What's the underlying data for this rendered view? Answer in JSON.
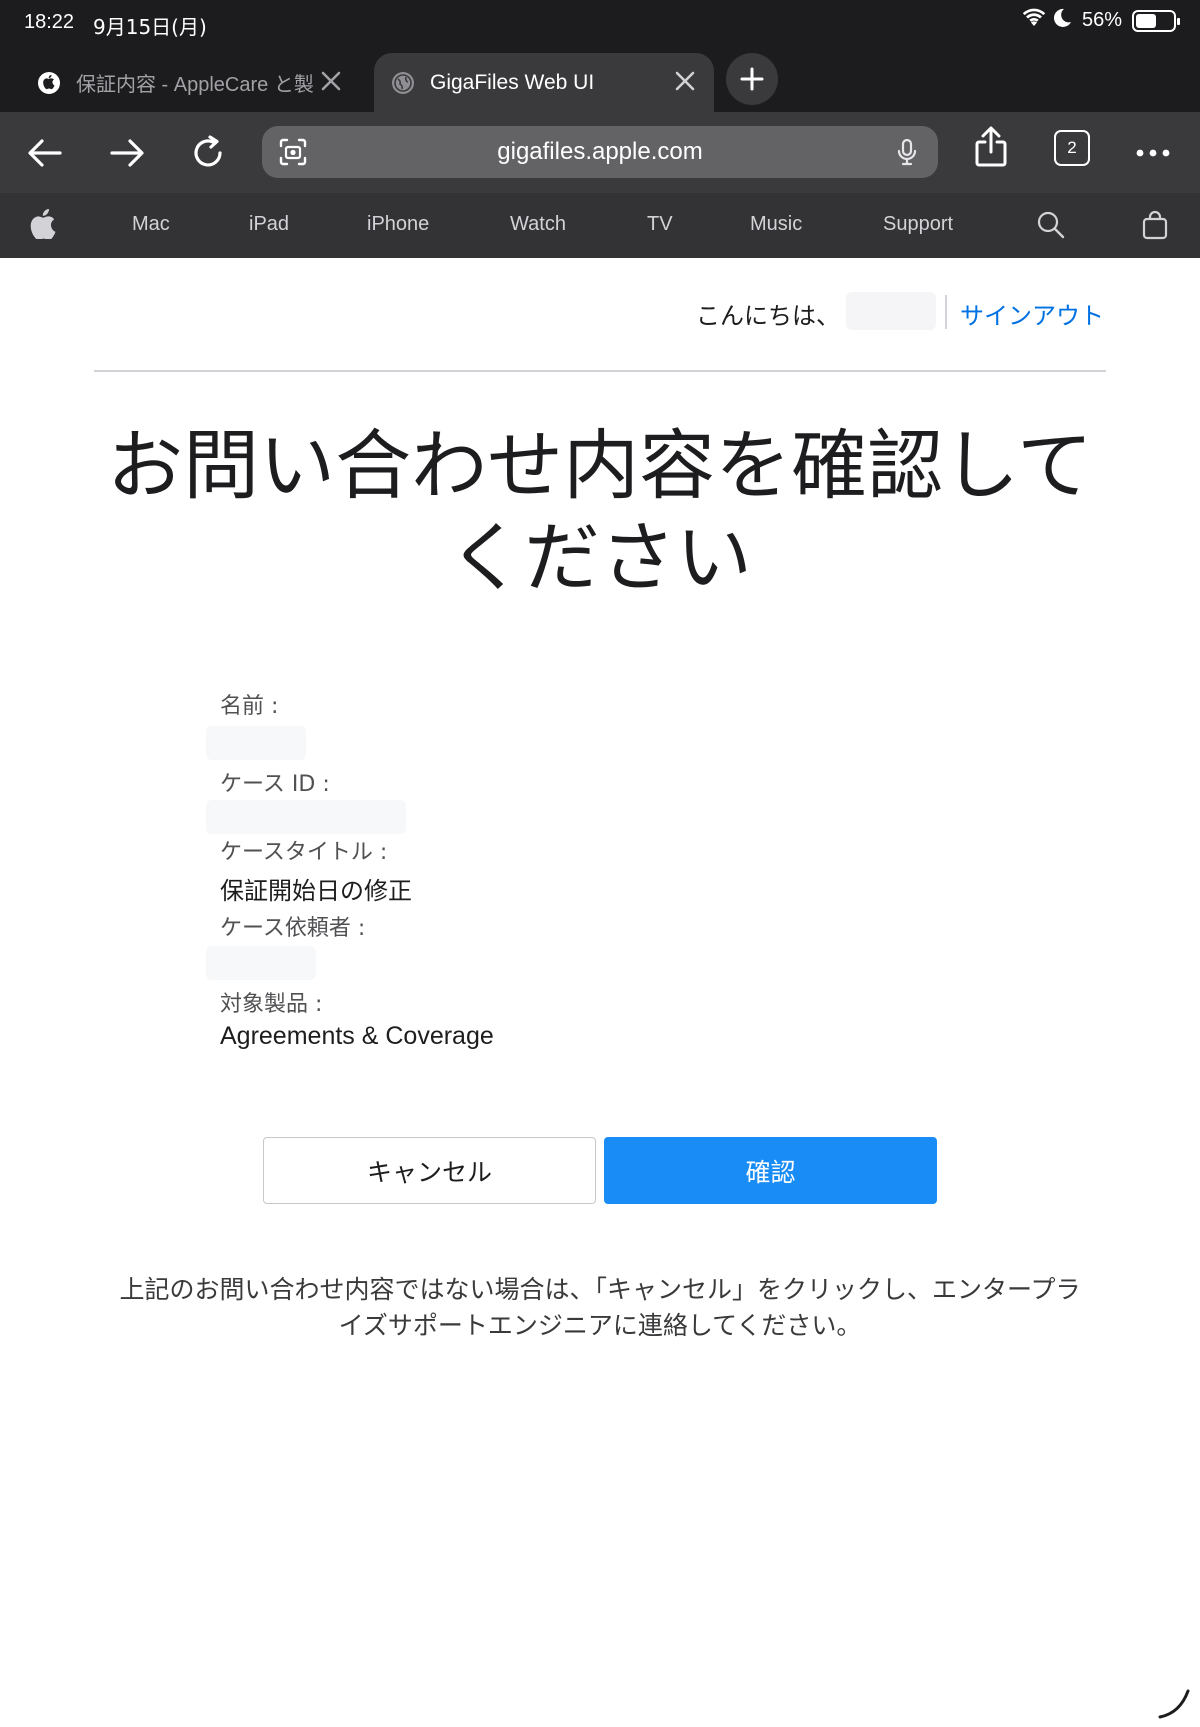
{
  "status_bar": {
    "time": "18:22",
    "date": "9月15日(月)",
    "battery_percent": "56%",
    "battery_level": 0.56
  },
  "tabs": [
    {
      "title": "保証内容 - AppleCare と製",
      "active": false
    },
    {
      "title": "GigaFiles Web UI",
      "active": true
    }
  ],
  "toolbar": {
    "url": "gigafiles.apple.com",
    "tab_count": "2"
  },
  "globalnav": {
    "items": [
      "Mac",
      "iPad",
      "iPhone",
      "Watch",
      "TV",
      "Music",
      "Support"
    ]
  },
  "header": {
    "greeting": "こんにちは、",
    "signout": "サインアウト"
  },
  "main": {
    "title_line1": "お問い合わせ内容を確認して",
    "title_line2": "ください",
    "fields": {
      "name_label": "名前 :",
      "case_id_label": "ケース ID :",
      "case_title_label": "ケースタイトル :",
      "case_title_value": "保証開始日の修正",
      "requester_label": "ケース依頼者 :",
      "product_label": "対象製品 :",
      "product_value": "Agreements & Coverage"
    },
    "cancel_label": "キャンセル",
    "confirm_label": "確認",
    "note_line1": "上記のお問い合わせ内容ではない場合は、「キャンセル」をクリックし、エンタープラ",
    "note_line2": "イズサポートエンジニアに連絡してください。"
  },
  "colors": {
    "accent": "#1a8cf5",
    "link": "#0071e3",
    "chrome": "#1c1c1e",
    "nav": "#333336"
  }
}
